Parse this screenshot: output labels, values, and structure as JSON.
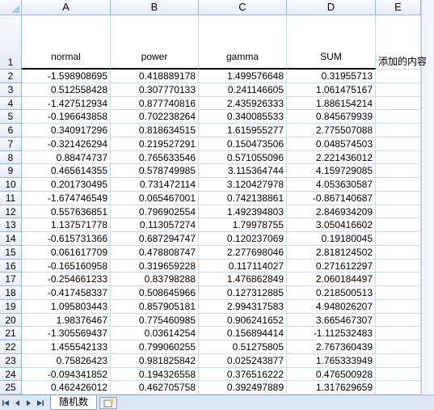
{
  "columns": [
    "A",
    "B",
    "C",
    "D",
    "E"
  ],
  "headers": {
    "A": "normal",
    "B": "power",
    "C": "gamma",
    "D": "SUM"
  },
  "note_cell": {
    "ref": "E1",
    "text": "添加的内容"
  },
  "rows": [
    {
      "n": "1"
    },
    {
      "n": "2",
      "A": "-1.598908695",
      "B": "0.418889178",
      "C": "1.499576648",
      "D": "0.31955713"
    },
    {
      "n": "3",
      "A": "0.512558428",
      "B": "0.307770133",
      "C": "0.241146605",
      "D": "1.061475167"
    },
    {
      "n": "4",
      "A": "-1.427512934",
      "B": "0.877740816",
      "C": "2.435926333",
      "D": "1.886154214"
    },
    {
      "n": "5",
      "A": "-0.196643858",
      "B": "0.702238264",
      "C": "0.340085533",
      "D": "0.845679939"
    },
    {
      "n": "6",
      "A": "0.340917296",
      "B": "0.818634515",
      "C": "1.615955277",
      "D": "2.775507088"
    },
    {
      "n": "7",
      "A": "-0.321426294",
      "B": "0.219527291",
      "C": "0.150473506",
      "D": "0.048574503"
    },
    {
      "n": "8",
      "A": "0.88474737",
      "B": "0.765633546",
      "C": "0.571055096",
      "D": "2.221436012"
    },
    {
      "n": "9",
      "A": "0.465614355",
      "B": "0.578749985",
      "C": "3.115364744",
      "D": "4.159729085"
    },
    {
      "n": "10",
      "A": "0.201730495",
      "B": "0.731472114",
      "C": "3.120427978",
      "D": "4.053630587"
    },
    {
      "n": "11",
      "A": "-1.674746549",
      "B": "0.065467001",
      "C": "0.742138861",
      "D": "-0.867140687"
    },
    {
      "n": "12",
      "A": "0.557636851",
      "B": "0.796902554",
      "C": "1.492394803",
      "D": "2.846934209"
    },
    {
      "n": "13",
      "A": "1.137571778",
      "B": "0.113057274",
      "C": "1.79978755",
      "D": "3.050416602"
    },
    {
      "n": "14",
      "A": "-0.615731366",
      "B": "0.687294747",
      "C": "0.120237069",
      "D": "0.19180045"
    },
    {
      "n": "15",
      "A": "0.061617709",
      "B": "0.478808747",
      "C": "2.277698046",
      "D": "2.818124502"
    },
    {
      "n": "16",
      "A": "-0.165160958",
      "B": "0.319659228",
      "C": "0.117114027",
      "D": "0.271612297"
    },
    {
      "n": "17",
      "A": "-0.254661233",
      "B": "0.83798288",
      "C": "1.476862849",
      "D": "2.060184497"
    },
    {
      "n": "18",
      "A": "-0.417458337",
      "B": "0.508645966",
      "C": "0.127312885",
      "D": "0.218500513"
    },
    {
      "n": "19",
      "A": "1.095803443",
      "B": "0.857905181",
      "C": "2.994317583",
      "D": "4.948026207"
    },
    {
      "n": "20",
      "A": "1.98376467",
      "B": "0.775460985",
      "C": "0.906241652",
      "D": "3.665467307"
    },
    {
      "n": "21",
      "A": "-1.305569437",
      "B": "0.03614254",
      "C": "0.156894414",
      "D": "-1.112532483"
    },
    {
      "n": "22",
      "A": "1.455542133",
      "B": "0.799060255",
      "C": "0.51275805",
      "D": "2.767360439"
    },
    {
      "n": "23",
      "A": "0.75826423",
      "B": "0.981825842",
      "C": "0.025243877",
      "D": "1.765333949"
    },
    {
      "n": "24",
      "A": "-0.094341852",
      "B": "0.194326558",
      "C": "0.376516222",
      "D": "0.476500928"
    },
    {
      "n": "25",
      "A": "0.462426012",
      "B": "0.462705758",
      "C": "0.392497889",
      "D": "1.317629659"
    }
  ],
  "sheet_tabs": [
    {
      "label": "随机数",
      "active": true
    }
  ],
  "nav_icons": [
    "first-sheet-icon",
    "prev-sheet-icon",
    "next-sheet-icon",
    "last-sheet-icon"
  ],
  "colors": {
    "header_bg": "#e4ecf7",
    "grid_line": "#d0d7e5",
    "header_border": "#9eb6ce",
    "tabbar_bg": "#dde7f3"
  }
}
